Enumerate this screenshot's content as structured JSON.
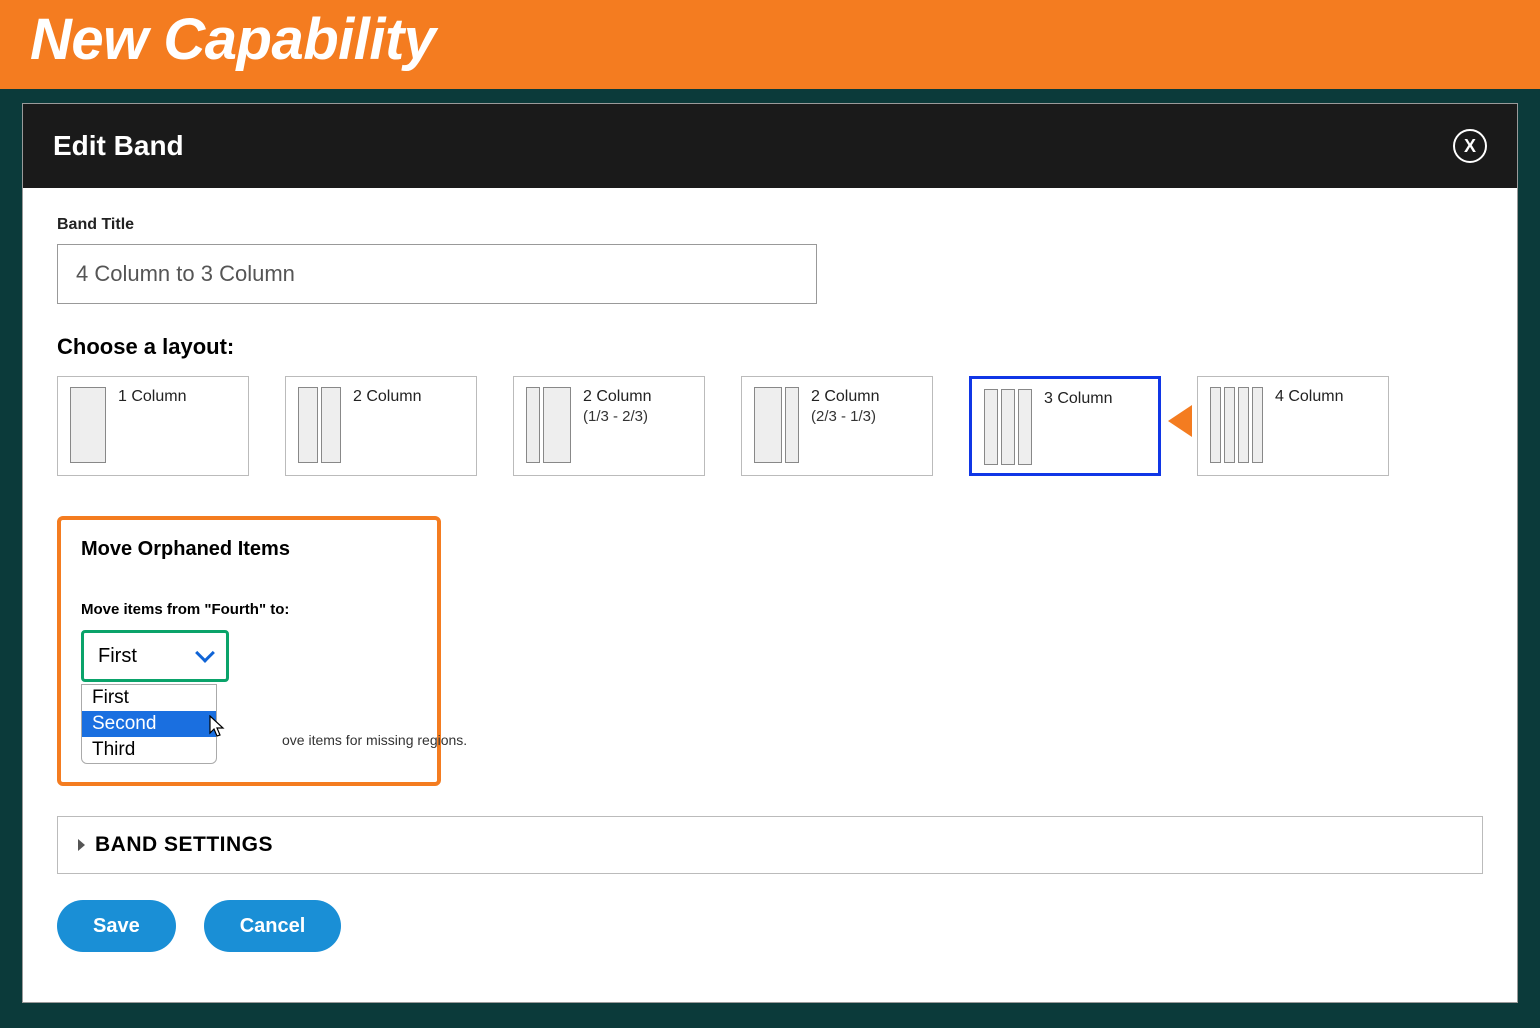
{
  "banner": {
    "title": "New Capability"
  },
  "dialog": {
    "title": "Edit Band",
    "close_label": "X",
    "band_title_label": "Band Title",
    "band_title_value": "4 Column to 3 Column",
    "choose_label": "Choose a layout:",
    "layouts": [
      {
        "label": "1 Column",
        "sub": ""
      },
      {
        "label": "2 Column",
        "sub": ""
      },
      {
        "label": "2 Column",
        "sub": "(1/3 - 2/3)"
      },
      {
        "label": "2 Column",
        "sub": "(2/3 - 1/3)"
      },
      {
        "label": "3 Column",
        "sub": ""
      },
      {
        "label": "4 Column",
        "sub": ""
      }
    ],
    "orphan": {
      "title": "Move Orphaned Items",
      "label": "Move items from \"Fourth\" to:",
      "selected": "First",
      "options": [
        "First",
        "Second",
        "Third"
      ],
      "hint": "ove items for missing regions."
    },
    "band_settings": "BAND SETTINGS",
    "buttons": {
      "save": "Save",
      "cancel": "Cancel"
    }
  }
}
